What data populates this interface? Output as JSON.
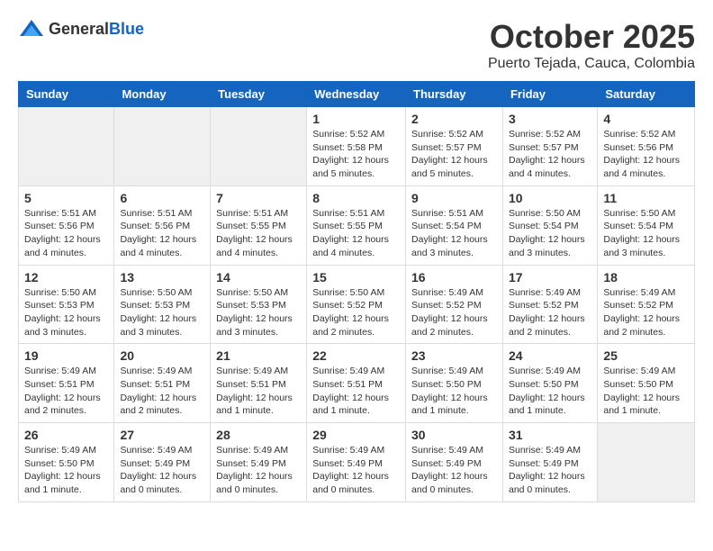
{
  "logo": {
    "general": "General",
    "blue": "Blue"
  },
  "title": {
    "month": "October 2025",
    "location": "Puerto Tejada, Cauca, Colombia"
  },
  "weekdays": [
    "Sunday",
    "Monday",
    "Tuesday",
    "Wednesday",
    "Thursday",
    "Friday",
    "Saturday"
  ],
  "weeks": [
    [
      {
        "day": "",
        "info": ""
      },
      {
        "day": "",
        "info": ""
      },
      {
        "day": "",
        "info": ""
      },
      {
        "day": "1",
        "info": "Sunrise: 5:52 AM\nSunset: 5:58 PM\nDaylight: 12 hours\nand 5 minutes."
      },
      {
        "day": "2",
        "info": "Sunrise: 5:52 AM\nSunset: 5:57 PM\nDaylight: 12 hours\nand 5 minutes."
      },
      {
        "day": "3",
        "info": "Sunrise: 5:52 AM\nSunset: 5:57 PM\nDaylight: 12 hours\nand 4 minutes."
      },
      {
        "day": "4",
        "info": "Sunrise: 5:52 AM\nSunset: 5:56 PM\nDaylight: 12 hours\nand 4 minutes."
      }
    ],
    [
      {
        "day": "5",
        "info": "Sunrise: 5:51 AM\nSunset: 5:56 PM\nDaylight: 12 hours\nand 4 minutes."
      },
      {
        "day": "6",
        "info": "Sunrise: 5:51 AM\nSunset: 5:56 PM\nDaylight: 12 hours\nand 4 minutes."
      },
      {
        "day": "7",
        "info": "Sunrise: 5:51 AM\nSunset: 5:55 PM\nDaylight: 12 hours\nand 4 minutes."
      },
      {
        "day": "8",
        "info": "Sunrise: 5:51 AM\nSunset: 5:55 PM\nDaylight: 12 hours\nand 4 minutes."
      },
      {
        "day": "9",
        "info": "Sunrise: 5:51 AM\nSunset: 5:54 PM\nDaylight: 12 hours\nand 3 minutes."
      },
      {
        "day": "10",
        "info": "Sunrise: 5:50 AM\nSunset: 5:54 PM\nDaylight: 12 hours\nand 3 minutes."
      },
      {
        "day": "11",
        "info": "Sunrise: 5:50 AM\nSunset: 5:54 PM\nDaylight: 12 hours\nand 3 minutes."
      }
    ],
    [
      {
        "day": "12",
        "info": "Sunrise: 5:50 AM\nSunset: 5:53 PM\nDaylight: 12 hours\nand 3 minutes."
      },
      {
        "day": "13",
        "info": "Sunrise: 5:50 AM\nSunset: 5:53 PM\nDaylight: 12 hours\nand 3 minutes."
      },
      {
        "day": "14",
        "info": "Sunrise: 5:50 AM\nSunset: 5:53 PM\nDaylight: 12 hours\nand 3 minutes."
      },
      {
        "day": "15",
        "info": "Sunrise: 5:50 AM\nSunset: 5:52 PM\nDaylight: 12 hours\nand 2 minutes."
      },
      {
        "day": "16",
        "info": "Sunrise: 5:49 AM\nSunset: 5:52 PM\nDaylight: 12 hours\nand 2 minutes."
      },
      {
        "day": "17",
        "info": "Sunrise: 5:49 AM\nSunset: 5:52 PM\nDaylight: 12 hours\nand 2 minutes."
      },
      {
        "day": "18",
        "info": "Sunrise: 5:49 AM\nSunset: 5:52 PM\nDaylight: 12 hours\nand 2 minutes."
      }
    ],
    [
      {
        "day": "19",
        "info": "Sunrise: 5:49 AM\nSunset: 5:51 PM\nDaylight: 12 hours\nand 2 minutes."
      },
      {
        "day": "20",
        "info": "Sunrise: 5:49 AM\nSunset: 5:51 PM\nDaylight: 12 hours\nand 2 minutes."
      },
      {
        "day": "21",
        "info": "Sunrise: 5:49 AM\nSunset: 5:51 PM\nDaylight: 12 hours\nand 1 minute."
      },
      {
        "day": "22",
        "info": "Sunrise: 5:49 AM\nSunset: 5:51 PM\nDaylight: 12 hours\nand 1 minute."
      },
      {
        "day": "23",
        "info": "Sunrise: 5:49 AM\nSunset: 5:50 PM\nDaylight: 12 hours\nand 1 minute."
      },
      {
        "day": "24",
        "info": "Sunrise: 5:49 AM\nSunset: 5:50 PM\nDaylight: 12 hours\nand 1 minute."
      },
      {
        "day": "25",
        "info": "Sunrise: 5:49 AM\nSunset: 5:50 PM\nDaylight: 12 hours\nand 1 minute."
      }
    ],
    [
      {
        "day": "26",
        "info": "Sunrise: 5:49 AM\nSunset: 5:50 PM\nDaylight: 12 hours\nand 1 minute."
      },
      {
        "day": "27",
        "info": "Sunrise: 5:49 AM\nSunset: 5:49 PM\nDaylight: 12 hours\nand 0 minutes."
      },
      {
        "day": "28",
        "info": "Sunrise: 5:49 AM\nSunset: 5:49 PM\nDaylight: 12 hours\nand 0 minutes."
      },
      {
        "day": "29",
        "info": "Sunrise: 5:49 AM\nSunset: 5:49 PM\nDaylight: 12 hours\nand 0 minutes."
      },
      {
        "day": "30",
        "info": "Sunrise: 5:49 AM\nSunset: 5:49 PM\nDaylight: 12 hours\nand 0 minutes."
      },
      {
        "day": "31",
        "info": "Sunrise: 5:49 AM\nSunset: 5:49 PM\nDaylight: 12 hours\nand 0 minutes."
      },
      {
        "day": "",
        "info": ""
      }
    ]
  ]
}
